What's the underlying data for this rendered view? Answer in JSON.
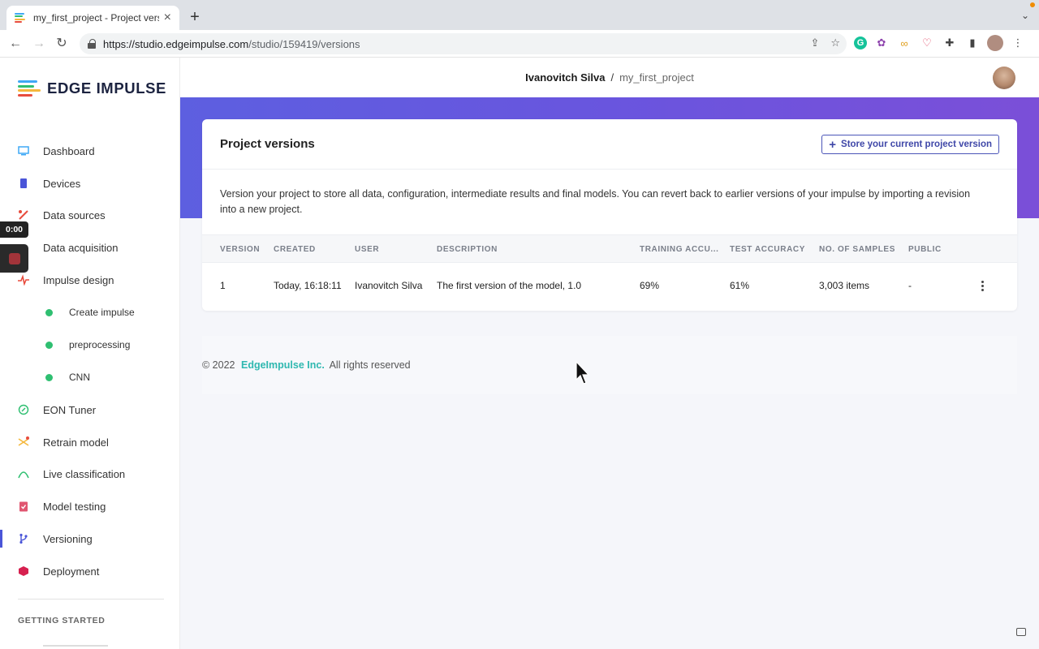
{
  "browser": {
    "tab_title": "my_first_project - Project vers",
    "url_host": "https://studio.edgeimpulse.com",
    "url_path": "/studio/159419/versions"
  },
  "brand": {
    "name": "EDGE IMPULSE",
    "colors": [
      "#3ea8f5",
      "#2fbf71",
      "#f5b83d",
      "#e84c3d"
    ]
  },
  "header": {
    "owner": "Ivanovitch Silva",
    "separator": "/",
    "project": "my_first_project"
  },
  "video": {
    "time": "0:00"
  },
  "sidebar": {
    "items": [
      {
        "label": "Dashboard",
        "icon": "monitor-icon",
        "color": "#3ea8f5"
      },
      {
        "label": "Devices",
        "icon": "chip-icon",
        "color": "#4a55d8"
      },
      {
        "label": "Data sources",
        "icon": "data-sources-icon",
        "color": "#e84c3d"
      },
      {
        "label": "Data acquisition",
        "icon": "database-icon",
        "color": "#2fbf71"
      },
      {
        "label": "Impulse design",
        "icon": "pulse-icon",
        "color": "#e84c3d"
      },
      {
        "label": "Create impulse",
        "sub": true
      },
      {
        "label": "preprocessing",
        "sub": true
      },
      {
        "label": "CNN",
        "sub": true
      },
      {
        "label": "EON Tuner",
        "icon": "compass-icon",
        "color": "#2fbf71"
      },
      {
        "label": "Retrain model",
        "icon": "shuffle-icon",
        "color": "#f5b83d"
      },
      {
        "label": "Live classification",
        "icon": "curve-icon",
        "color": "#2fbf71"
      },
      {
        "label": "Model testing",
        "icon": "clipboard-check-icon",
        "color": "#e05570"
      },
      {
        "label": "Versioning",
        "icon": "git-branch-icon",
        "color": "#4a55d8",
        "active": true
      },
      {
        "label": "Deployment",
        "icon": "box-icon",
        "color": "#d6204f"
      }
    ],
    "section_label": "GETTING STARTED"
  },
  "card": {
    "title": "Project versions",
    "store_button": "Store your current project version",
    "description": "Version your project to store all data, configuration, intermediate results and final models. You can revert back to earlier versions of your impulse by importing a revision into a new project.",
    "columns": [
      "VERSION",
      "CREATED",
      "USER",
      "DESCRIPTION",
      "TRAINING ACCU...",
      "TEST ACCURACY",
      "NO. OF SAMPLES",
      "PUBLIC"
    ],
    "rows": [
      {
        "version": "1",
        "created": "Today, 16:18:11",
        "user": "Ivanovitch Silva",
        "description": "The first version of the model, 1.0",
        "training_accuracy": "69%",
        "test_accuracy": "61%",
        "samples": "3,003 items",
        "public": "-"
      }
    ]
  },
  "footer": {
    "copyright": "© 2022",
    "company": "EdgeImpulse Inc.",
    "rights": "All rights reserved"
  }
}
